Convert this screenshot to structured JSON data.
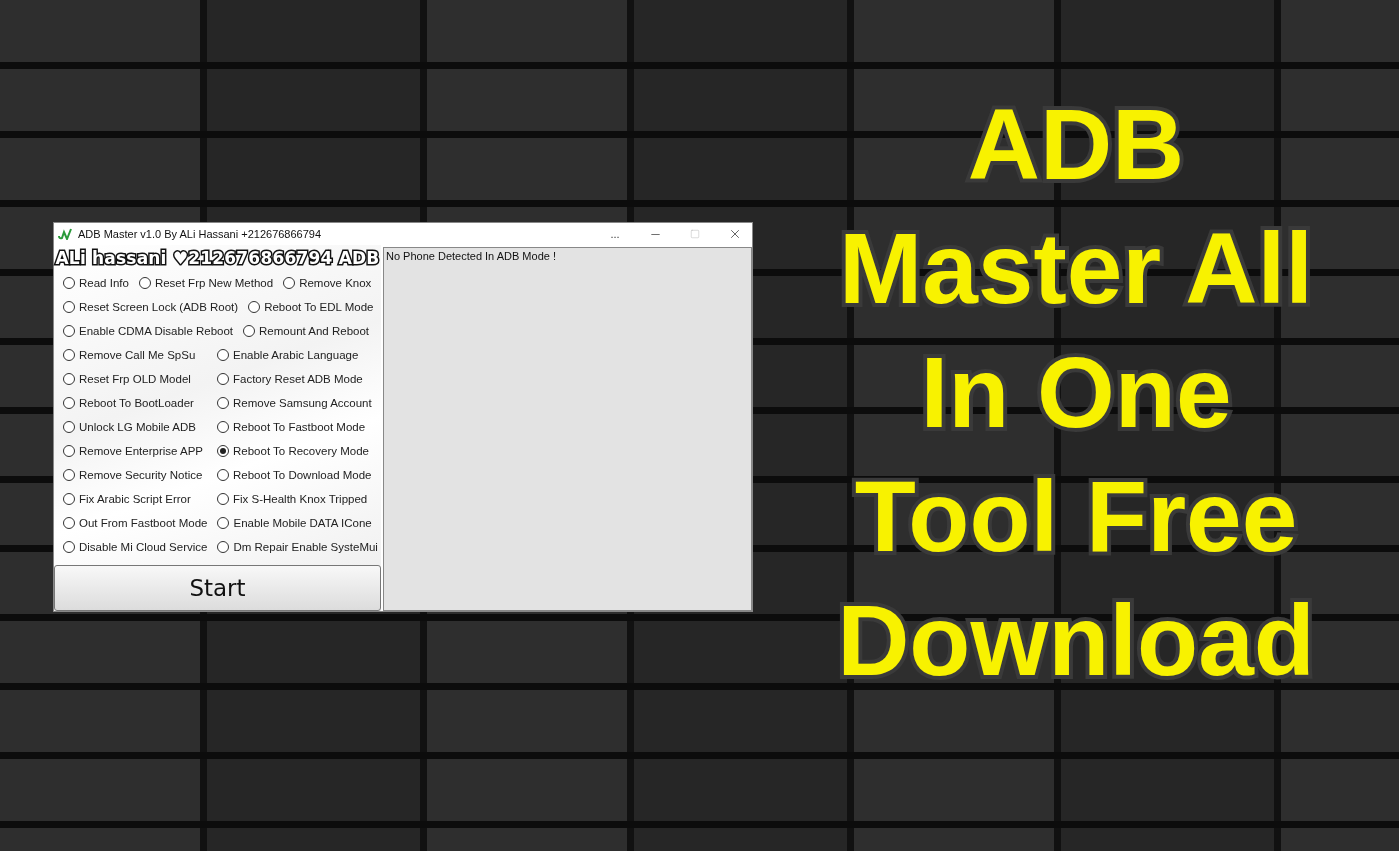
{
  "window": {
    "title": "ADB Master v1.0 By ALi Hassani +212676866794",
    "overflow_label": "..."
  },
  "banner": "ALi hassani ♥212676866794 ADB",
  "options": [
    [
      {
        "label": "Read Info",
        "selected": false
      },
      {
        "label": "Reset Frp New Method",
        "selected": false
      },
      {
        "label": "Remove Knox",
        "selected": false
      }
    ],
    [
      {
        "label": "Reset Screen Lock (ADB Root)",
        "selected": false
      },
      {
        "label": "Reboot To EDL Mode",
        "selected": false
      }
    ],
    [
      {
        "label": "Enable CDMA  Disable Reboot",
        "selected": false
      },
      {
        "label": "Remount And Reboot",
        "selected": false
      }
    ],
    [
      {
        "label": "Remove Call Me SpSu",
        "selected": false
      },
      {
        "label": "Enable Arabic Language",
        "selected": false
      }
    ],
    [
      {
        "label": "Reset Frp OLD Model",
        "selected": false
      },
      {
        "label": "Factory Reset ADB Mode",
        "selected": false
      }
    ],
    [
      {
        "label": "Reboot To BootLoader",
        "selected": false
      },
      {
        "label": "Remove Samsung Account",
        "selected": false
      }
    ],
    [
      {
        "label": "Unlock LG Mobile ADB",
        "selected": false
      },
      {
        "label": "Reboot To Fastboot Mode",
        "selected": false
      }
    ],
    [
      {
        "label": "Remove Enterprise APP",
        "selected": false
      },
      {
        "label": "Reboot To Recovery Mode",
        "selected": true
      }
    ],
    [
      {
        "label": "Remove Security Notice",
        "selected": false
      },
      {
        "label": "Reboot To Download Mode",
        "selected": false
      }
    ],
    [
      {
        "label": "Fix Arabic Script Error",
        "selected": false
      },
      {
        "label": "Fix S-Health Knox Tripped",
        "selected": false
      }
    ],
    [
      {
        "label": "Out From Fastboot Mode",
        "selected": false
      },
      {
        "label": "Enable Mobile DATA ICone",
        "selected": false
      }
    ],
    [
      {
        "label": "Disable Mi Cloud Service",
        "selected": false
      },
      {
        "label": "Dm Repair Enable SysteMui",
        "selected": false
      }
    ]
  ],
  "start_button": "Start",
  "log": "No Phone Detected In ADB Mode !",
  "headline": [
    "ADB",
    "Master All",
    "In One",
    "Tool Free",
    "Download"
  ]
}
